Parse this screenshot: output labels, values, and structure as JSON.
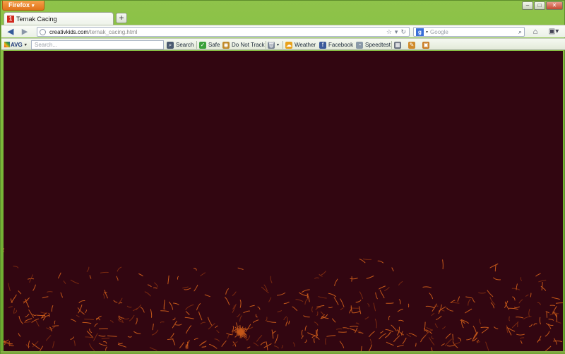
{
  "window": {
    "app_menu_label": "Firefox",
    "controls": {
      "minimize": "–",
      "maximize": "□",
      "close": "✕"
    }
  },
  "tabs": [
    {
      "title": "Ternak Cacing",
      "favicon": "1",
      "active": true
    }
  ],
  "new_tab_label": "+",
  "navigation": {
    "back_icon": "◀",
    "forward_icon": "▶",
    "url_host": "creativkids.com",
    "url_path": "/ternak_cacing.html",
    "url_icons": [
      "☆",
      "▾",
      "↻"
    ],
    "search_engine": "Google",
    "search_engine_icon": "g",
    "search_icon": "⌕",
    "home_icon": "⌂",
    "bookmarks_icon": "▣▾"
  },
  "avg_toolbar": {
    "logo_text": "AVG",
    "search_placeholder": "Search...",
    "buttons": [
      {
        "label": "Search",
        "icon": "search-icon",
        "glyph": "⌕",
        "color": "#4a5a70"
      },
      {
        "label": "Safe",
        "icon": "shield-icon",
        "glyph": "✓",
        "color": "#3aa03a"
      },
      {
        "label": "Do Not Track",
        "icon": "do-not-track-icon",
        "glyph": "◉",
        "color": "#c08a2a"
      },
      {
        "label": "",
        "icon": "trash-icon",
        "glyph": "🗑",
        "color": "#7a8594"
      },
      {
        "label": "Weather",
        "icon": "weather-icon",
        "glyph": "☁",
        "color": "#e8a21c"
      },
      {
        "label": "Facebook",
        "icon": "facebook-icon",
        "glyph": "f",
        "color": "#3b5a9a"
      },
      {
        "label": "Speedtest",
        "icon": "speedtest-icon",
        "glyph": "◔",
        "color": "#8a9aa8"
      },
      {
        "label": "",
        "icon": "calendar-icon",
        "glyph": "▦",
        "color": "#6a7280"
      },
      {
        "label": "",
        "icon": "note-icon",
        "glyph": "✎",
        "color": "#d08a2a"
      },
      {
        "label": "",
        "icon": "photo-icon",
        "glyph": "▣",
        "color": "#c87a20"
      }
    ]
  },
  "content": {
    "background": "#320611",
    "worm_color": "#c4581a",
    "worm_color_dim": "#7a2a10"
  }
}
